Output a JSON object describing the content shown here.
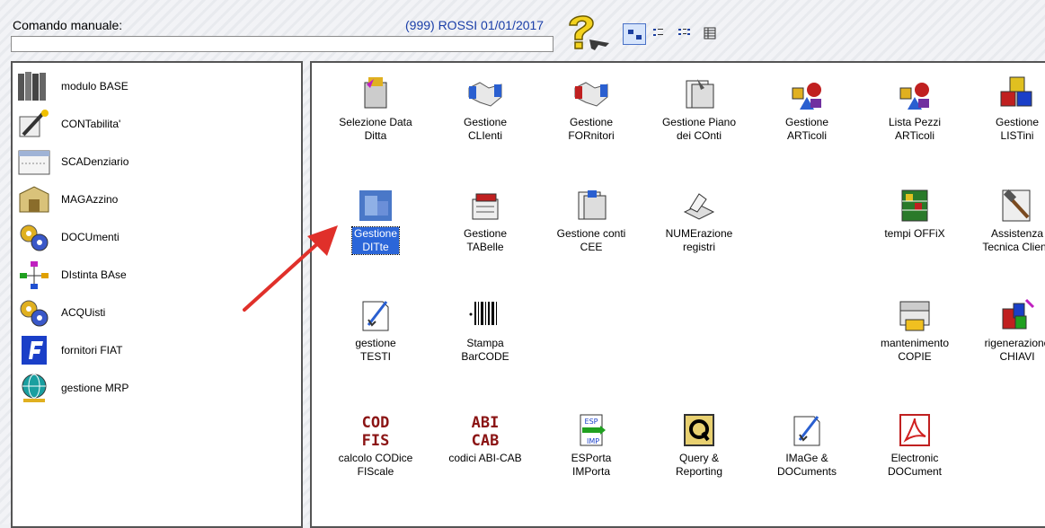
{
  "header": {
    "command_label": "Comando manuale:",
    "command_value": "",
    "user_info": "(999) ROSSI 01/01/2017",
    "help_icon": "help-question-icon",
    "view_buttons": [
      {
        "name": "view-large-icons",
        "icon": "large-icons-icon",
        "active": true
      },
      {
        "name": "view-small-icons",
        "icon": "small-icons-icon",
        "active": false
      },
      {
        "name": "view-list",
        "icon": "list-view-icon",
        "active": false
      },
      {
        "name": "view-details",
        "icon": "details-view-icon",
        "active": false
      }
    ]
  },
  "sidebar": {
    "items": [
      {
        "label": "modulo BASE",
        "icon": "books-icon"
      },
      {
        "label": "CONTabilita'",
        "icon": "pen-ledger-icon"
      },
      {
        "label": "SCADenziario",
        "icon": "calendar-icon"
      },
      {
        "label": "MAGAzzino",
        "icon": "warehouse-box-icon"
      },
      {
        "label": "DOCUmenti",
        "icon": "documents-gears-icon"
      },
      {
        "label": "DIstinta BAse",
        "icon": "bill-of-materials-icon"
      },
      {
        "label": "ACQUisti",
        "icon": "purchases-gears-icon"
      },
      {
        "label": "fornitori FIAT",
        "icon": "fiat-f-icon"
      },
      {
        "label": "gestione MRP",
        "icon": "globe-mrp-icon"
      }
    ]
  },
  "main": {
    "items": [
      {
        "label": "Selezione Data\nDitta",
        "icon": "calendar-select-icon"
      },
      {
        "label": "Gestione\nCLIenti",
        "icon": "handshake-blue-icon"
      },
      {
        "label": "Gestione\nFORnitori",
        "icon": "handshake-red-icon"
      },
      {
        "label": "Gestione Piano\ndei COnti",
        "icon": "folders-icon"
      },
      {
        "label": "Gestione\nARTicoli",
        "icon": "shapes-icon"
      },
      {
        "label": "Lista Pezzi\nARTicoli",
        "icon": "shapes-list-icon"
      },
      {
        "label": "Gestione\nLISTini",
        "icon": "color-blocks-icon"
      },
      {
        "label": "Gestione\nDITte",
        "icon": "company-icon",
        "selected": true
      },
      {
        "label": "Gestione\nTABelle",
        "icon": "card-file-icon"
      },
      {
        "label": "Gestione conti\nCEE",
        "icon": "cee-folders-icon"
      },
      {
        "label": "NUMErazione\nregistri",
        "icon": "register-icon"
      },
      {
        "label": "tempi OFFiX",
        "icon": "timesheet-icon"
      },
      {
        "label": "Assistenza\nTecnica Clienti",
        "icon": "hammer-icon"
      },
      {
        "label": "gestione\nTESTI",
        "icon": "text-edit-icon"
      },
      {
        "label": "Stampa\nBarCODE",
        "icon": "barcode-icon"
      },
      {
        "label": "mantenimento\nCOPIE",
        "icon": "backup-printer-icon"
      },
      {
        "label": "rigenerazione\nCHIAVI",
        "icon": "keys-blocks-icon"
      },
      {
        "label": "calcolo CODice\nFIScale",
        "icon": "cod-fis-icon",
        "glyph": [
          "COD",
          "FIS"
        ]
      },
      {
        "label": "codici ABI-CAB",
        "icon": "abi-cab-icon",
        "glyph": [
          "ABI",
          "CAB"
        ]
      },
      {
        "label": "ESPorta\nIMPorta",
        "icon": "export-import-icon",
        "glyph": [
          "ESP",
          "IMP"
        ]
      },
      {
        "label": "Query &\nReporting",
        "icon": "query-q-icon"
      },
      {
        "label": "IMaGe &\nDOCuments",
        "icon": "image-doc-icon"
      },
      {
        "label": "Electronic\nDOCument",
        "icon": "pdf-icon"
      }
    ]
  },
  "colors": {
    "accent": "#2b66d9",
    "user_info": "#1a3ea8",
    "arrow": "#e0302a",
    "codes_text": "#8b1414"
  }
}
